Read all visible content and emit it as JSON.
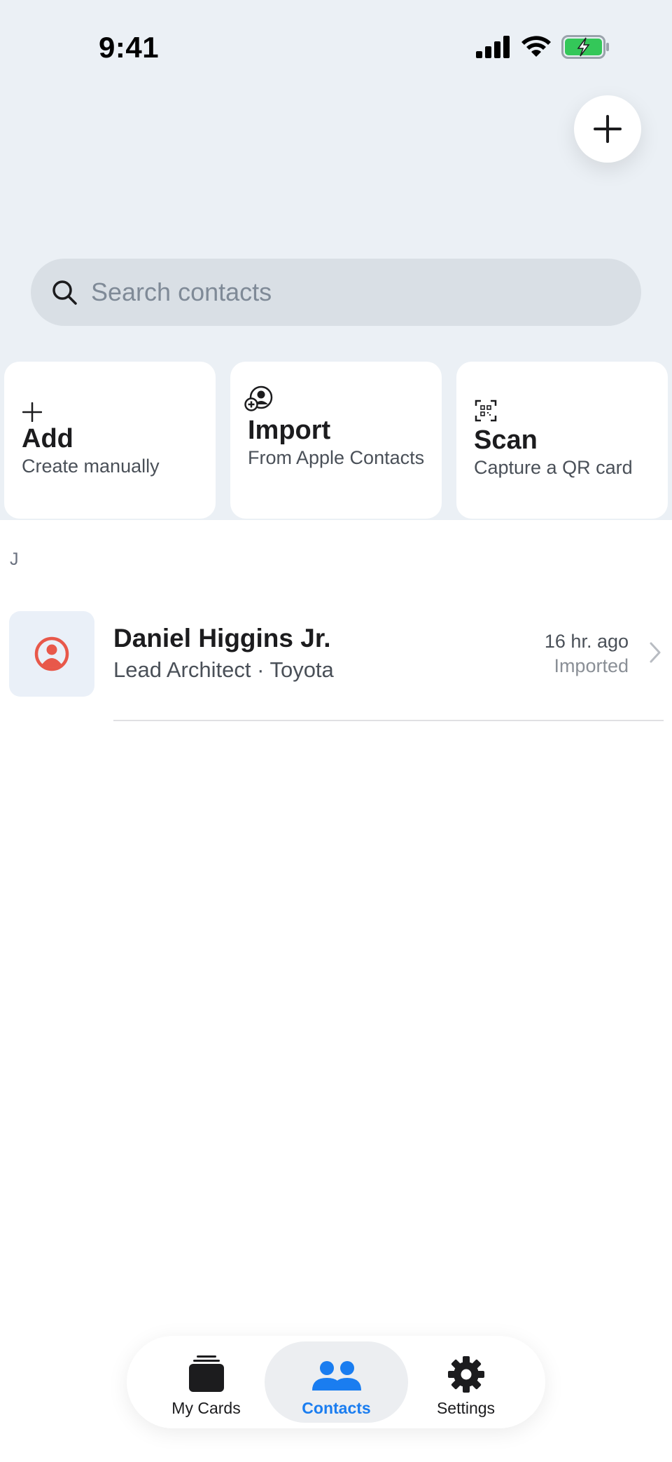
{
  "status_bar": {
    "time": "9:41"
  },
  "search": {
    "placeholder": "Search contacts"
  },
  "actions": [
    {
      "title": "Add",
      "subtitle": "Create manually",
      "icon": "plus-icon"
    },
    {
      "title": "Import",
      "subtitle": "From Apple Contacts",
      "icon": "person-add-icon"
    },
    {
      "title": "Scan",
      "subtitle": "Capture a QR card",
      "icon": "qr-scan-icon"
    }
  ],
  "sections": [
    {
      "letter": "J",
      "contacts": [
        {
          "name": "Daniel Higgins Jr.",
          "subtitle": "Lead Architect · Toyota",
          "time": "16 hr. ago",
          "status": "Imported"
        }
      ]
    }
  ],
  "tabs": [
    {
      "label": "My Cards",
      "icon": "cards-icon",
      "active": false
    },
    {
      "label": "Contacts",
      "icon": "people-icon",
      "active": true
    },
    {
      "label": "Settings",
      "icon": "gear-icon",
      "active": false
    }
  ],
  "colors": {
    "accent": "#1a7df0",
    "avatar_red": "#e8584a",
    "battery_green": "#34c759"
  }
}
